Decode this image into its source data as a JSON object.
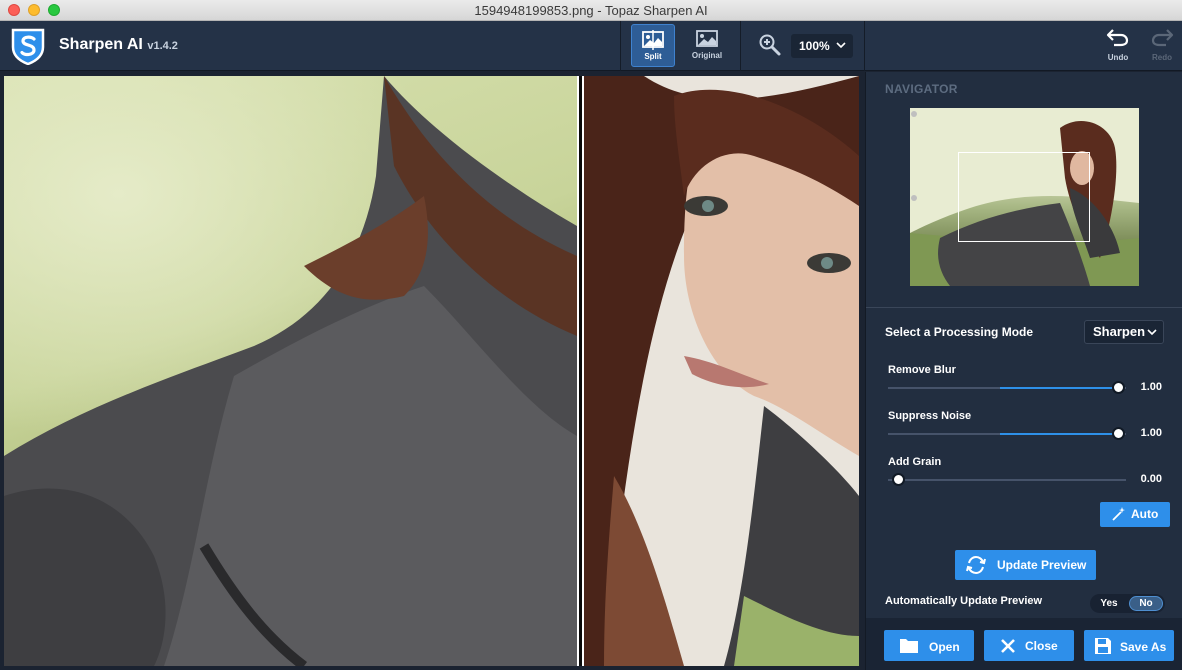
{
  "window": {
    "title": "1594948199853.png - Topaz Sharpen AI"
  },
  "app": {
    "name": "Sharpen AI",
    "version": "v1.4.2"
  },
  "toolbar": {
    "view_modes": [
      {
        "label": "Split",
        "active": true
      },
      {
        "label": "Original",
        "active": false
      }
    ],
    "zoom_level": "100%",
    "undo_label": "Undo",
    "redo_label": "Redo",
    "redo_enabled": false
  },
  "navigator": {
    "title": "NAVIGATOR"
  },
  "processing": {
    "mode_label": "Select a Processing Mode",
    "mode_value": "Sharpen",
    "sliders": [
      {
        "label": "Remove Blur",
        "value": "1.00",
        "fraction": 1.0
      },
      {
        "label": "Suppress Noise",
        "value": "1.00",
        "fraction": 1.0
      },
      {
        "label": "Add Grain",
        "value": "0.00",
        "fraction": 0.0
      }
    ],
    "auto_label": "Auto",
    "update_preview_label": "Update Preview",
    "auto_update_label": "Automatically Update Preview",
    "auto_update_yes": "Yes",
    "auto_update_no": "No",
    "auto_update_selected": "No"
  },
  "footer": {
    "open_label": "Open",
    "close_label": "Close",
    "save_as_label": "Save As"
  },
  "colors": {
    "accent": "#2e8fea",
    "toolbar_bg": "#243247",
    "panel_bg": "#222e40"
  }
}
